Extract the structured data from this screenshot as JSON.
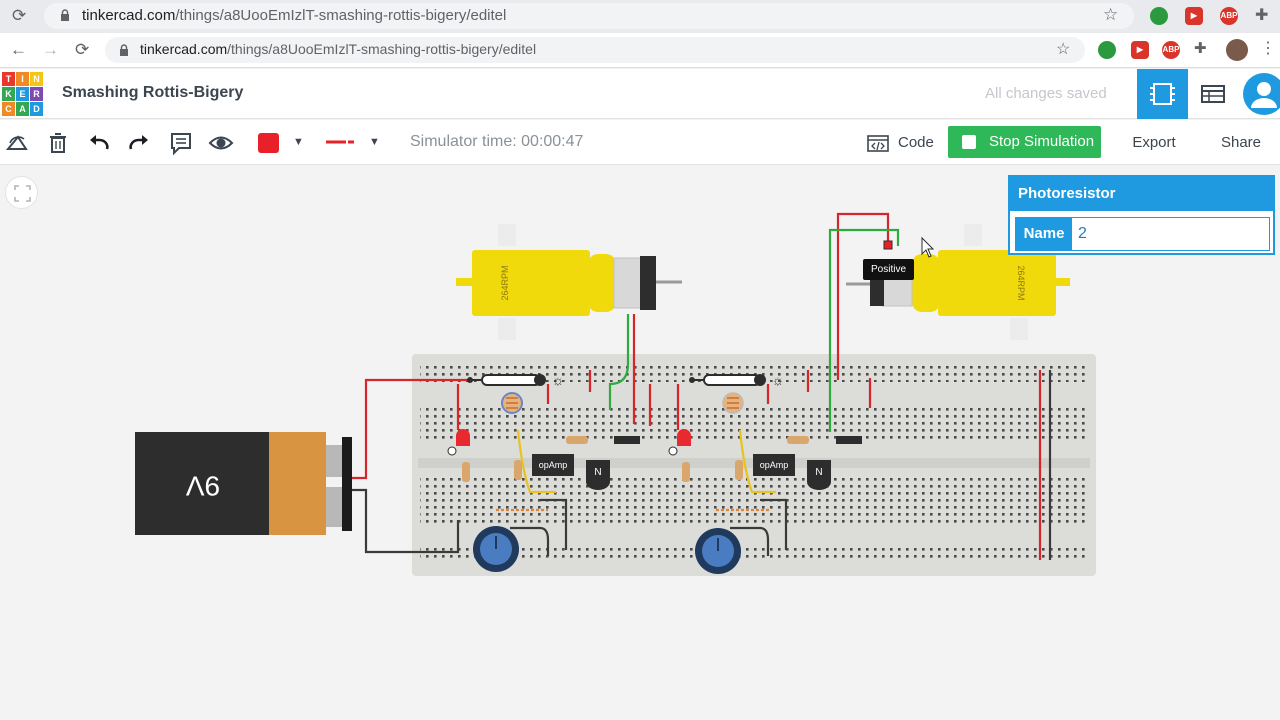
{
  "browser": {
    "outer_url_host": "tinkercad.com",
    "outer_url_path": "/things/a8UooEmIzlT-smashing-rottis-bigery/editel",
    "inner_url_host": "tinkercad.com",
    "inner_url_path": "/things/a8UooEmIzlT-smashing-rottis-bigery/editel",
    "abp_label": "ABP"
  },
  "app": {
    "logo_letters": [
      "T",
      "I",
      "N",
      "K",
      "E",
      "R",
      "C",
      "A",
      "D"
    ],
    "design_title": "Smashing Rottis-Bigery",
    "save_status": "All changes saved"
  },
  "toolbar": {
    "simulator_time": "Simulator time: 00:00:47",
    "code_label": "Code",
    "stop_label": "Stop Simulation",
    "export_label": "Export",
    "share_label": "Share",
    "fill_color": "#e8202a"
  },
  "inspector": {
    "title": "Photoresistor",
    "name_label": "Name",
    "name_value": "2"
  },
  "canvas": {
    "battery_label": "9V",
    "motor_left_label": "264RPM",
    "motor_right_label": "264RPM",
    "opamp_label": "opAmp",
    "transistor_label": "N",
    "tooltip": "Positive"
  },
  "colors": {
    "accent": "#1f9ae0",
    "stop_green": "#2eb857",
    "motor_yellow": "#f0da0c"
  }
}
